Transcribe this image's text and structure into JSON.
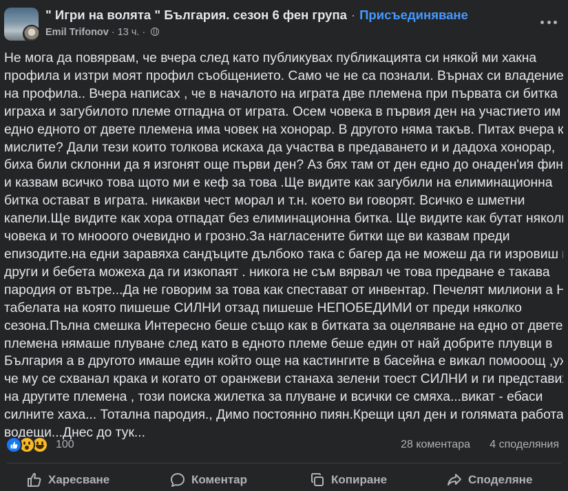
{
  "post": {
    "group_name": "\" Игри на волята \" България. сезон 6 фен група",
    "separator": "·",
    "join_label": "Присъединяване",
    "author": "Emil Trifonov",
    "time": "13 ч.",
    "body_lines": [
      "Не мога да повярвам, че вчера след като публикувах публикацията си някой ми хакна",
      "профила и изтри моят профил съобщението. Само че не са познали. Върнах си владението",
      "на профила.. Вчера написах  , че в началото на играта две племена  при първата си битка",
      "играха и загубилото племе отпадна от играта. Осем човека в първия ден на участието им  .В",
      "едно едното от двете племена има човек на хонорар. В другото няма такъв. Питах вчера как",
      "мислите? Дали тези които толкова искаха да участва в предаването и и  дадоха хонорар,",
      "биха били склонни да я изгонят още първи ден? Аз бях там от ден едно до онаден'ия финал.",
      "и казвам всичко това щото ми е кеф за това .Ще видите как загубили на елиминационна",
      "битка остават в играта. никакви чест морал и т.н. което ви говорят. Всичко е шметни",
      "капели.Ще видите как хора  отпадат без елиминационна битка. Ще видите как бутат няколко",
      "човека и то мнооого очевидно и грозно.За нагласените битки ще ви казвам преди",
      "епизодите.на едни заравяха сандъците дълбоко така с багер да не можеш да ги изровиш на",
      "други и бебета можеха да ги изкопаят .  никога не съм вярвал че това предване е такава",
      "пародия от вътре...Да не говорим за това как спестават от инвентар. Печелят милиони а На",
      "табелата на която пишеше СИЛНИ отзад пишеше НЕПОБЕДИМИ от преди няколко",
      "сезона.Пълна смешка Интересно беше също как в битката за оцеляване на едно от двете",
      "племена нямаше плуване след като в едното племе беше един от най добрите плувци в",
      "България а в другото имаше един  който още на кастингите в басейна е викал помооощ ,уж",
      "че му се схванал крака и когато от оранжеви станаха зелени тоест СИЛНИ и ги представиха",
      "на другите племена , този поиска жилетка за плуване и всички се смяха...викат - ебаси",
      "силните хаха... Тотална пародия., Димо постоянно пиян.Крещи цял ден и голямата работа",
      "водещи...Днес до тук..."
    ],
    "reactions": {
      "icons": [
        "like-icon",
        "wow-icon",
        "haha-icon"
      ],
      "count": "100",
      "comments": "28 коментара",
      "shares": "4 споделяния"
    },
    "actions": {
      "like": "Харесване",
      "comment": "Коментар",
      "copy": "Копиране",
      "share": "Споделяне"
    }
  },
  "colors": {
    "background": "#242526",
    "text_primary": "#e4e6eb",
    "text_secondary": "#b0b3b8",
    "join_link": "#4599ff",
    "like_blue": "#1877f2",
    "emoji_yellow": "#f7b928"
  }
}
